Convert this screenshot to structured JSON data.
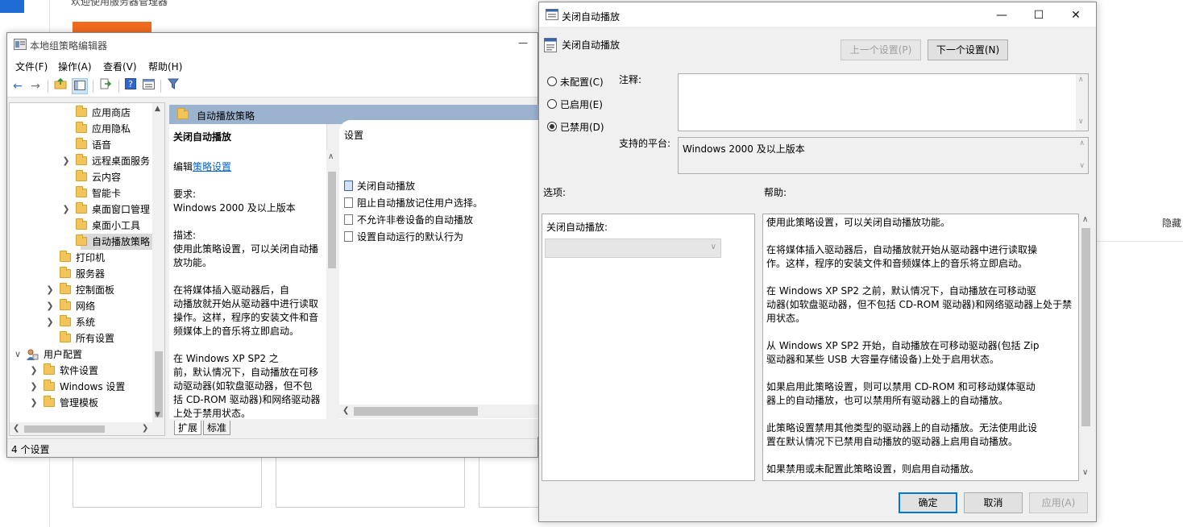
{
  "background": {
    "title": "欢迎使用服务器管理器",
    "hide_label": "隐藏"
  },
  "gpedit": {
    "title": "本地组策略编辑器",
    "minimize_glyph": "—",
    "menu": [
      "文件(F)",
      "操作(A)",
      "查看(V)",
      "帮助(H)"
    ],
    "toolbar_icons": [
      "back-arrow-icon",
      "forward-arrow-icon",
      "up-folder-icon",
      "show-hide-tree-icon",
      "export-list-icon",
      "help-icon",
      "properties-icon",
      "filter-icon"
    ],
    "tree": [
      {
        "label": "应用商店",
        "level": 3,
        "expandable": false
      },
      {
        "label": "应用隐私",
        "level": 3,
        "expandable": false
      },
      {
        "label": "语音",
        "level": 3,
        "expandable": false
      },
      {
        "label": "远程桌面服务",
        "level": 3,
        "expandable": true
      },
      {
        "label": "云内容",
        "level": 3,
        "expandable": false
      },
      {
        "label": "智能卡",
        "level": 3,
        "expandable": false
      },
      {
        "label": "桌面窗口管理",
        "level": 3,
        "expandable": true
      },
      {
        "label": "桌面小工具",
        "level": 3,
        "expandable": false
      },
      {
        "label": "自动播放策略",
        "level": 3,
        "expandable": false,
        "selected": true
      },
      {
        "label": "打印机",
        "level": 2,
        "expandable": false
      },
      {
        "label": "服务器",
        "level": 2,
        "expandable": false
      },
      {
        "label": "控制面板",
        "level": 2,
        "expandable": true
      },
      {
        "label": "网络",
        "level": 2,
        "expandable": true
      },
      {
        "label": "系统",
        "level": 2,
        "expandable": true
      },
      {
        "label": "所有设置",
        "level": 2,
        "expandable": false
      },
      {
        "label": "用户配置",
        "level": 0,
        "expandable": true,
        "expanded": true,
        "user": true
      },
      {
        "label": "软件设置",
        "level": 1,
        "expandable": true
      },
      {
        "label": "Windows 设置",
        "level": 1,
        "expandable": true
      },
      {
        "label": "管理模板",
        "level": 1,
        "expandable": true
      }
    ],
    "middle": {
      "header": "自动播放策略",
      "policy_title": "关闭自动播放",
      "edit_prefix": "编辑",
      "edit_link": "策略设置",
      "requirements_label": "要求:",
      "requirements_value": "Windows 2000 及以上版本",
      "desc_label": "描述:",
      "desc_lines": [
        "使用此策略设置，可以关闭自动播",
        "放功能。",
        "",
        "        在将媒体插入驱动器后，自",
        "动播放就开始从驱动器中进行读取",
        "操作。这样，程序的安装文件和音",
        "频媒体上的音乐将立即启动。",
        "",
        "        在 Windows XP SP2 之",
        "前，默认情况下，自动播放在可移",
        "动驱动器(如软盘驱动器，但不包",
        "括 CD-ROM 驱动器)和网络驱动器",
        "上处于禁用状态。"
      ],
      "list_header": "设置",
      "list_items": [
        "关闭自动播放",
        "阻止自动播放记住用户选择。",
        "不允许非卷设备的自动播放",
        "设置自动运行的默认行为"
      ],
      "tabs": [
        "扩展",
        "标准"
      ]
    },
    "status": "4 个设置"
  },
  "dialog": {
    "title": "关闭自动播放",
    "subtitle": "关闭自动播放",
    "controls": {
      "minimize": "—",
      "maximize": "☐",
      "close": "✕"
    },
    "prev_button": "上一个设置(P)",
    "next_button": "下一个设置(N)",
    "radios": [
      {
        "label": "未配置(C)",
        "checked": false
      },
      {
        "label": "已启用(E)",
        "checked": false
      },
      {
        "label": "已禁用(D)",
        "checked": true
      }
    ],
    "comment_label": "注释:",
    "platform_label": "支持的平台:",
    "platform_value": "Windows 2000 及以上版本",
    "options_label": "选项:",
    "help_label": "帮助:",
    "options_field_label": "关闭自动播放:",
    "options_select_value": "",
    "help_lines": [
      "使用此策略设置，可以关闭自动播放功能。",
      "",
      "        在将媒体插入驱动器后，自动播放就开始从驱动器中进行读取操",
      "作。这样，程序的安装文件和音频媒体上的音乐将立即启动。",
      "",
      "        在 Windows XP SP2 之前，默认情况下，自动播放在可移动驱",
      "动器(如软盘驱动器，但不包括 CD-ROM 驱动器)和网络驱动器上处于禁",
      "用状态。",
      "",
      "        从 Windows XP SP2 开始，自动播放在可移动驱动器(包括 Zip",
      "驱动器和某些 USB 大容量存储设备)上处于启用状态。",
      "",
      "        如果启用此策略设置，则可以禁用 CD-ROM 和可移动媒体驱动",
      "器上的自动播放，也可以禁用所有驱动器上的自动播放。",
      "",
      "        此策略设置禁用其他类型的驱动器上的自动播放。无法使用此设",
      "置在默认情况下已禁用自动播放的驱动器上启用自动播放。",
      "",
      "        如果禁用或未配置此策略设置，则启用自动播放。"
    ],
    "ok_button": "确定",
    "cancel_button": "取消",
    "apply_button": "应用(A)"
  }
}
